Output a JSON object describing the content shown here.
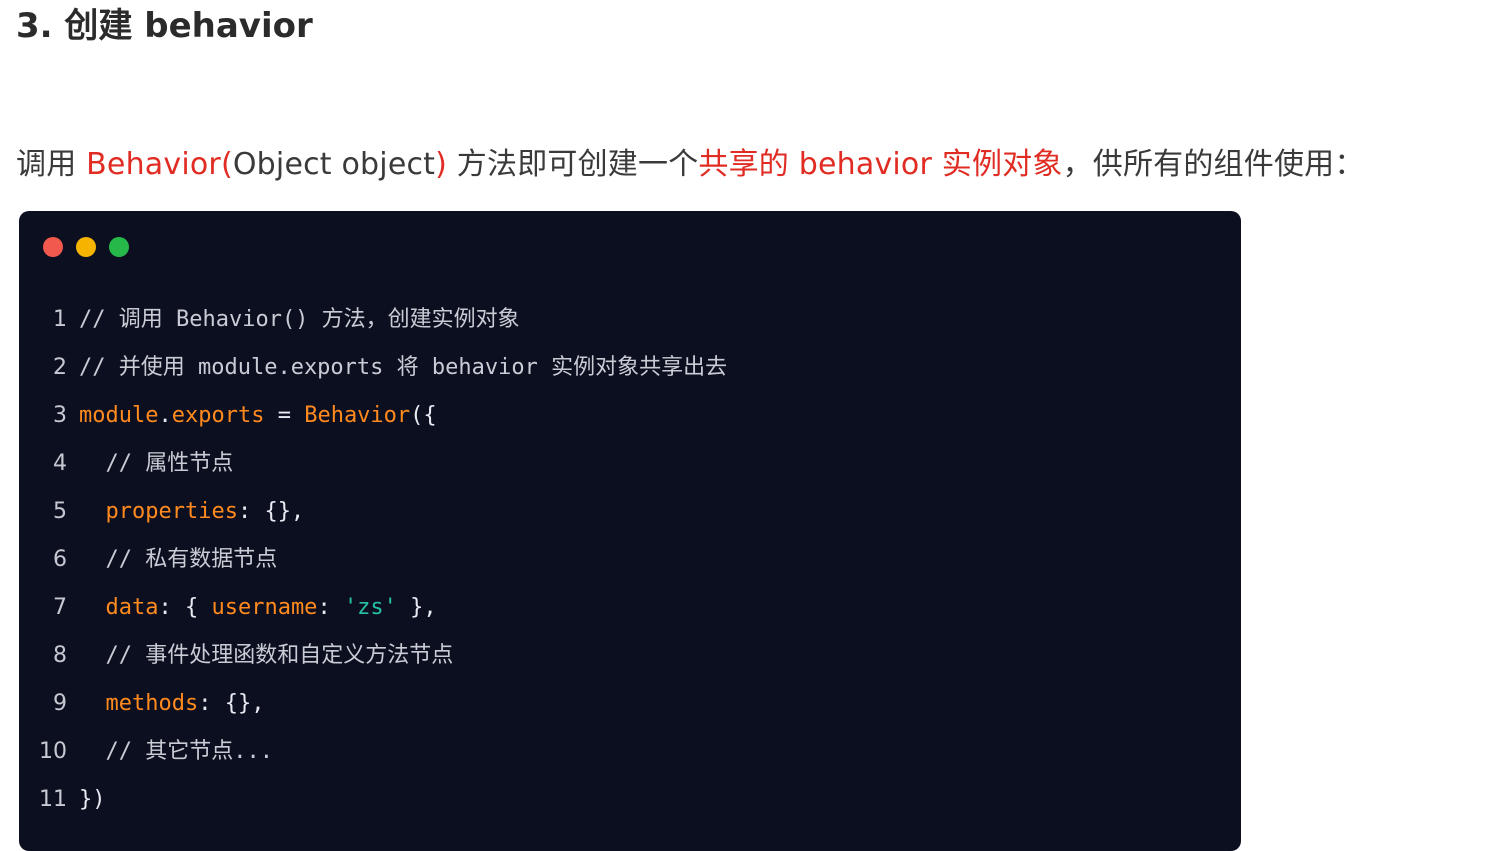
{
  "heading": "3. 创建 behavior",
  "intro": {
    "p1": "调用 ",
    "h1": "Behavior(",
    "p2": "Object object",
    "h2": ")",
    "p3": " 方法即可创建一个",
    "h3": "共享的 behavior 实例对象",
    "p4": "，供所有的组件使用："
  },
  "window_dots": [
    "#f2594e",
    "#f6b400",
    "#27b84a"
  ],
  "code": {
    "line_numbers": [
      "1",
      "2",
      "3",
      "4",
      "5",
      "6",
      "7",
      "8",
      "9",
      "10",
      "11"
    ],
    "l1": "// 调用 Behavior() 方法，创建实例对象",
    "l2": "// 并使用 module.exports 将 behavior 实例对象共享出去",
    "l3_a": "module",
    "l3_b": ".",
    "l3_c": "exports",
    "l3_d": " = ",
    "l3_e": "Behavior",
    "l3_f": "({",
    "l4": "  // 属性节点",
    "l5_indent": "  ",
    "l5_a": "properties",
    "l5_b": ": {},",
    "l6": "  // 私有数据节点",
    "l7_indent": "  ",
    "l7_a": "data",
    "l7_b": ": { ",
    "l7_c": "username",
    "l7_d": ": ",
    "l7_e": "'zs'",
    "l7_f": " },",
    "l8": "  // 事件处理函数和自定义方法节点",
    "l9_indent": "  ",
    "l9_a": "methods",
    "l9_b": ": {},",
    "l10": "  // 其它节点...",
    "l11": "})"
  }
}
